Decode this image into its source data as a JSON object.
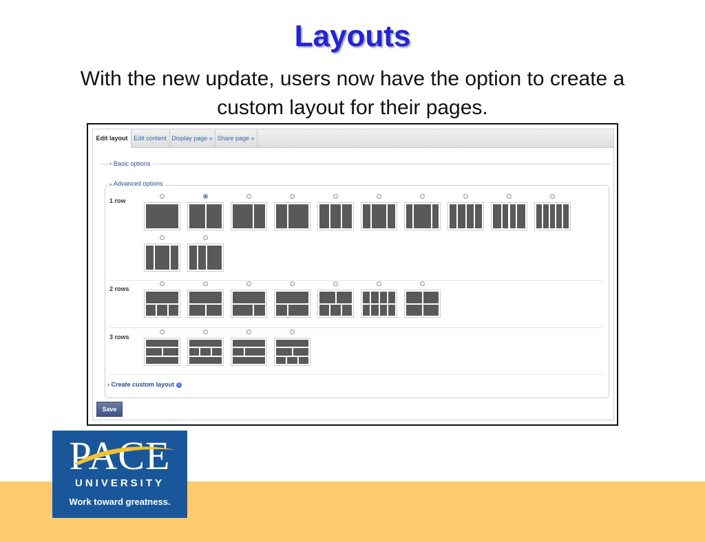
{
  "slide": {
    "title": "Layouts",
    "subtitle_line1": "With the new update, users now have the option to create a",
    "subtitle_line2": "custom layout for their pages."
  },
  "screenshot": {
    "tabs": [
      {
        "label": "Edit layout",
        "active": true
      },
      {
        "label": "Edit content",
        "active": false
      },
      {
        "label": "Display page »",
        "active": false
      },
      {
        "label": "Share page »",
        "active": false
      }
    ],
    "basic_options_label": "Basic options",
    "advanced_options_label": "Advanced options",
    "rows": [
      {
        "label": "1 row",
        "layout_count": 12,
        "selected_index": 1
      },
      {
        "label": "2 rows",
        "layout_count": 7,
        "selected_index": null
      },
      {
        "label": "3 rows",
        "layout_count": 4,
        "selected_index": null
      }
    ],
    "create_custom_label": "Create custom layout",
    "save_label": "Save",
    "colors": {
      "accent": "#2a4b8d",
      "layout_block": "#595959",
      "button": "#3e5284"
    },
    "icons": {
      "expand": "chevron-right-icon",
      "collapse": "chevron-down-icon",
      "info": "info-icon"
    }
  },
  "logo": {
    "name": "PACE",
    "university": "UNIVERSITY",
    "tagline": "Work toward greatness.",
    "colors": {
      "background": "#1a569a",
      "swoosh": "#f2c230"
    }
  },
  "colors": {
    "title": "#2323d8",
    "bottom_band": "#fdcb6e"
  }
}
